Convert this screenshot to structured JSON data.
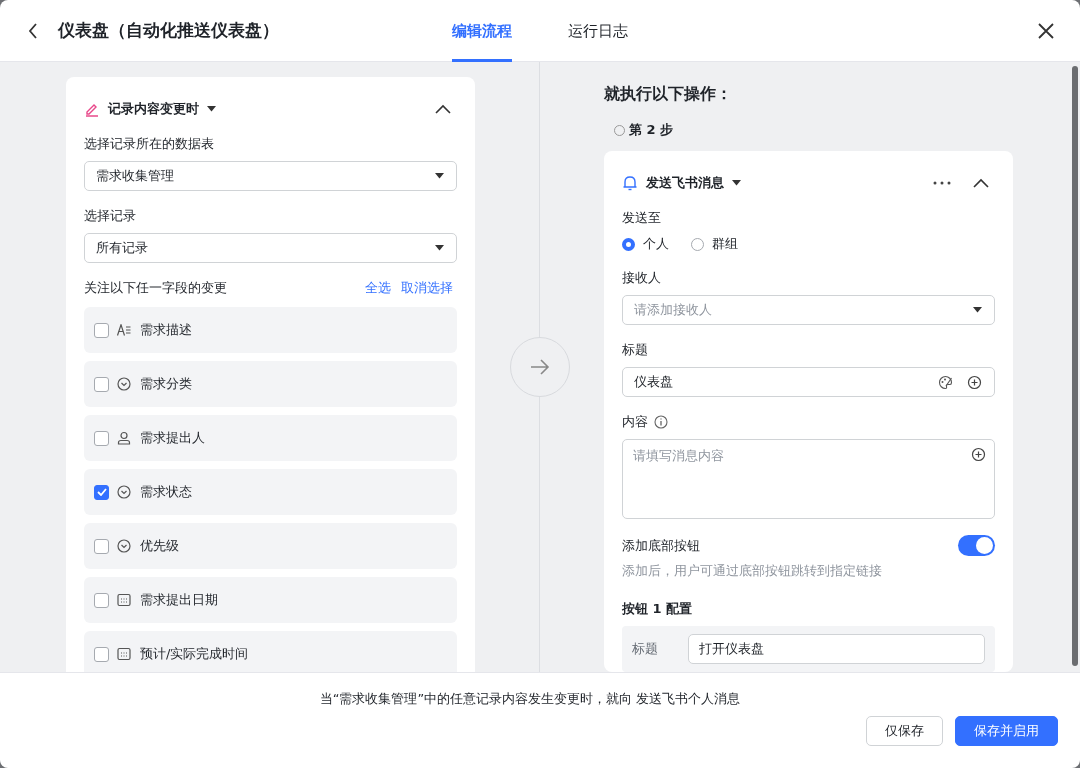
{
  "window": {
    "title": "仪表盘（自动化推送仪表盘）"
  },
  "tabs": [
    {
      "label": "编辑流程",
      "selected": true
    },
    {
      "label": "运行日志",
      "selected": false
    }
  ],
  "trigger": {
    "title": "记录内容变更时",
    "expanded": true,
    "fields": [
      {
        "label": "选择记录所在的数据表",
        "value": "需求收集管理"
      },
      {
        "label": "选择记录",
        "value": "所有记录"
      }
    ],
    "watch_label": "关注以下任一字段的变更",
    "select_all": "全选",
    "deselect": "取消选择",
    "items": [
      {
        "label": "需求描述",
        "kind": "text",
        "checked": false
      },
      {
        "label": "需求分类",
        "kind": "option",
        "checked": false
      },
      {
        "label": "需求提出人",
        "kind": "person",
        "checked": false
      },
      {
        "label": "需求状态",
        "kind": "option",
        "checked": true
      },
      {
        "label": "优先级",
        "kind": "option",
        "checked": false
      },
      {
        "label": "需求提出日期",
        "kind": "date",
        "checked": false
      },
      {
        "label": "预计/实际完成时间",
        "kind": "date",
        "checked": false
      }
    ]
  },
  "action": {
    "heading": "就执行以下操作：",
    "step": "第 2 步",
    "title": "发送飞书消息",
    "expanded": true,
    "send_to": {
      "label": "发送至",
      "options": [
        {
          "label": "个人",
          "selected": true
        },
        {
          "label": "群组",
          "selected": false
        }
      ]
    },
    "recipient": {
      "label": "接收人",
      "placeholder": "请添加接收人"
    },
    "title_field": {
      "label": "标题",
      "value": "仪表盘"
    },
    "content": {
      "label": "内容",
      "placeholder": "请填写消息内容"
    },
    "bottom_button": {
      "label": "添加底部按钮",
      "on": true,
      "hint": "添加后，用户可通过底部按钮跳转到指定链接"
    },
    "button_config": {
      "label": "按钮 1 配置",
      "field_label": "标题",
      "value": "打开仪表盘"
    }
  },
  "footer": {
    "summary": "当“需求收集管理”中的任意记录内容发生变更时，就向 发送飞书个人消息",
    "buttons": [
      {
        "label": "仅保存",
        "kind": "secondary"
      },
      {
        "label": "保存并启用",
        "kind": "primary"
      }
    ]
  }
}
